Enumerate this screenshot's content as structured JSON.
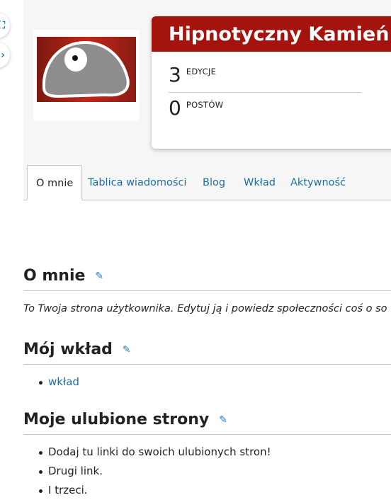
{
  "profile": {
    "name": "Hipnotyczny Kamień",
    "stats": [
      {
        "value": "3",
        "label": "EDYCJE"
      },
      {
        "value": "0",
        "label": "POSTÓW"
      }
    ]
  },
  "tabs": [
    {
      "label": "O mnie",
      "active": true
    },
    {
      "label": "Tablica wiadomości",
      "active": false
    },
    {
      "label": "Blog",
      "active": false
    },
    {
      "label": "Wkład",
      "active": false
    },
    {
      "label": "Aktywność",
      "active": false
    }
  ],
  "sections": {
    "about": {
      "heading": "O mnie",
      "text": "To Twoja strona użytkownika. Edytuj ją i powiedz społeczności coś o so"
    },
    "contributions": {
      "heading": "Mój wkład",
      "items": [
        "wkład"
      ]
    },
    "favorites": {
      "heading": "Moje ulubione strony",
      "items": [
        "Dodaj tu linki do swoich ulubionych stron!",
        "Drugi link.",
        "I trzeci."
      ]
    }
  },
  "colors": {
    "accent": "#a5130f",
    "link": "#1f6ea3"
  }
}
